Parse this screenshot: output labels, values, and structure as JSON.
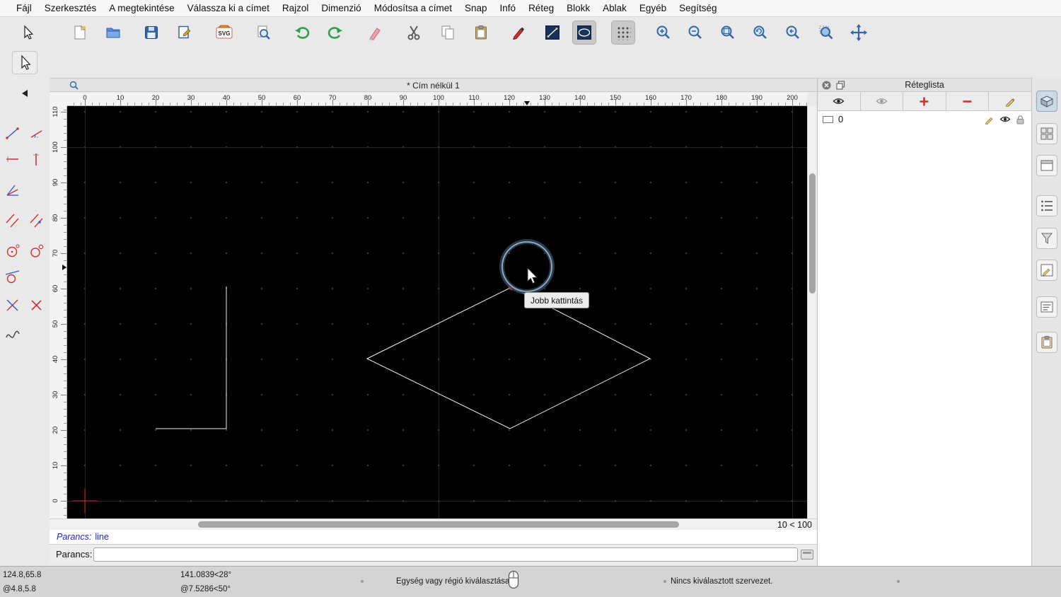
{
  "menubar": {
    "items": [
      "Fájl",
      "Szerkesztés",
      "A megtekintése",
      "Válassza ki a címet",
      "Rajzol",
      "Dimenzió",
      "Módosítsa a címet",
      "Snap",
      "Infó",
      "Réteg",
      "Blokk",
      "Ablak",
      "Egyéb",
      "Segítség"
    ]
  },
  "toolbar": {
    "svg_badge": "SVG"
  },
  "document": {
    "title": "* Cím nélkül 1"
  },
  "rulers": {
    "h": [
      "0",
      "10",
      "20",
      "30",
      "40",
      "50",
      "60",
      "70",
      "80",
      "90",
      "100",
      "110",
      "120",
      "130",
      "140",
      "150",
      "160",
      "170",
      "180",
      "190",
      "200"
    ],
    "v": [
      "0",
      "10",
      "20",
      "30",
      "40",
      "50",
      "60",
      "70",
      "80",
      "90",
      "100",
      "110"
    ]
  },
  "canvas": {
    "tooltip": "Jobb kattintás",
    "grid_indicator": "10 < 100"
  },
  "command": {
    "history_prompt": "Parancs:",
    "history_text": "line",
    "input_label": "Parancs:",
    "input_value": ""
  },
  "layer_panel": {
    "title": "Réteglista",
    "layers": [
      {
        "name": "0"
      }
    ]
  },
  "statusbar": {
    "coord_abs": "124.8,65.8",
    "coord_rel": "@4.8,5.8",
    "angle_abs": "141.0839<28°",
    "angle_rel": "@7.5286<50°",
    "hint": "Egység vagy régió kiválasztása",
    "selection": "Nincs kiválasztott szervezet."
  },
  "colors": {
    "accent_blue": "#3465a4",
    "entity_white": "#f0f0f0",
    "origin_red": "#cc2222",
    "command_blue": "#2222cc"
  }
}
